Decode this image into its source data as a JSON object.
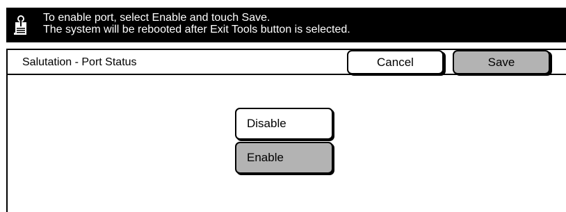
{
  "message": {
    "icon": "info-document-icon",
    "line1": "To enable port, select Enable and touch Save.",
    "line2": "The system will be rebooted after Exit Tools button is selected."
  },
  "header": {
    "title": "Salutation - Port Status",
    "cancel_label": "Cancel",
    "save_label": "Save"
  },
  "options": {
    "disable_label": "Disable",
    "enable_label": "Enable",
    "selected": "Enable"
  },
  "colors": {
    "message_bg": "#000000",
    "selected_bg": "#b3b3b3",
    "default_bg": "#ffffff"
  }
}
